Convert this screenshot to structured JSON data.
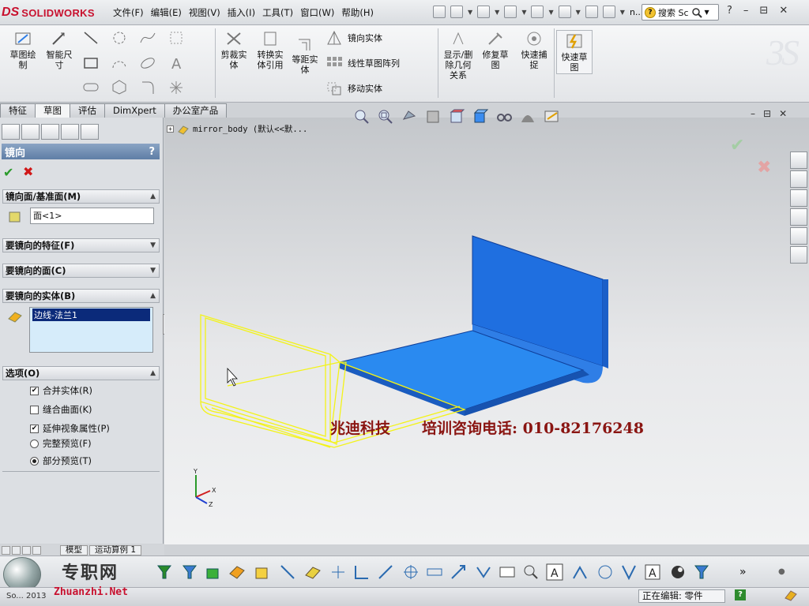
{
  "app": {
    "logo_ds": "DS",
    "logo_text": "SOLIDWORKS"
  },
  "menu": [
    "文件(F)",
    "编辑(E)",
    "视图(V)",
    "插入(I)",
    "工具(T)",
    "窗口(W)",
    "帮助(H)"
  ],
  "quick_more": "n...",
  "search": {
    "text": "搜索 Sc"
  },
  "window_controls": [
    "?",
    "–",
    "⊟",
    "✕"
  ],
  "ribbon": {
    "sketch": "草图绘\n制",
    "smart_dim": "智能尺\n寸",
    "trim": "剪裁实\n体",
    "convert": "转换实\n体引用",
    "offset": "等距实\n体",
    "mirror_entities": "镜向实体",
    "linear_pattern": "线性草图阵列",
    "move_entities": "移动实体",
    "display_relations": "显示/删\n除几何\n关系",
    "repair": "修复草\n图",
    "quick_snaps": "快速捕\n捉",
    "rapid_sketch": "快速草\n图"
  },
  "tabs": [
    "特征",
    "草图",
    "评估",
    "DimXpert",
    "办公室产品"
  ],
  "active_tab": 1,
  "property_manager": {
    "title": "镜向",
    "help": "?",
    "sections": {
      "mirror_plane": "镜向面/基准面(M)",
      "mirror_plane_value": "面<1>",
      "features": "要镜向的特征(F)",
      "faces": "要镜向的面(C)",
      "bodies": "要镜向的实体(B)",
      "bodies_value": "边线-法兰1",
      "options": "选项(O)"
    },
    "options": [
      {
        "label": "合并实体(R)",
        "type": "checkbox",
        "checked": true
      },
      {
        "label": "缝合曲面(K)",
        "type": "checkbox",
        "checked": false
      },
      {
        "label": "延伸视象属性(P)",
        "type": "checkbox",
        "checked": true
      },
      {
        "label": "完整预览(F)",
        "type": "radio",
        "checked": false
      },
      {
        "label": "部分预览(T)",
        "type": "radio",
        "checked": true
      }
    ]
  },
  "tree": {
    "node": "mirror_body  (默认<<默..."
  },
  "watermark": {
    "company": "兆迪科技",
    "phone": "培训咨询电话: 010-82176248"
  },
  "triad": {
    "x": "X",
    "y": "Y",
    "z": "Z"
  },
  "bottom_tabs": [
    "模型",
    "运动算例 1"
  ],
  "status": {
    "editing": "正在编辑: 零件",
    "help": "?"
  },
  "site": {
    "cn": "专职网",
    "en": "Zhuanzhi.Net",
    "version": "So...  2013"
  },
  "colors": {
    "accent_blue": "#2f7ee6",
    "preview_yellow": "#f3f318",
    "title_red": "#c8102e",
    "watermark": "#8a1512"
  }
}
